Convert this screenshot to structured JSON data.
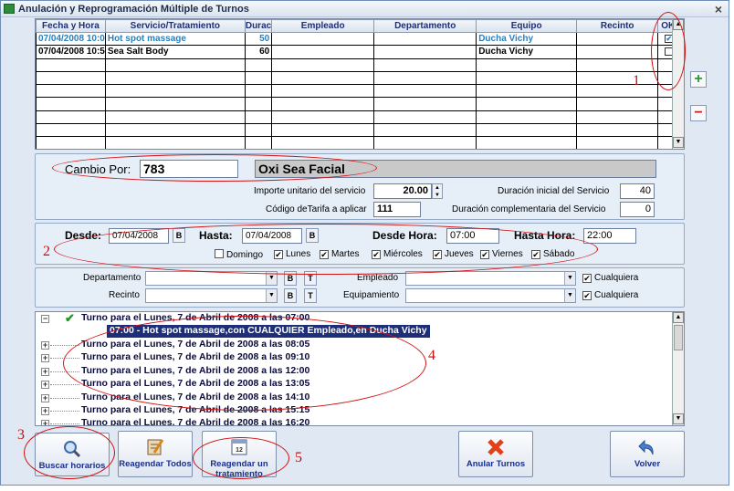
{
  "window": {
    "title": "Anulación y Reprogramación Múltiple de Turnos",
    "close": "×"
  },
  "grid": {
    "columns": [
      "Fecha y Hora",
      "Servicio/Tratamiento",
      "Durac",
      "Empleado",
      "Departamento",
      "Equipo",
      "Recinto",
      "OK"
    ],
    "rows": [
      {
        "fecha": "07/04/2008 10:0",
        "servicio": "Hot spot massage",
        "dur": "50",
        "empleado": "",
        "depto": "",
        "equipo": "Ducha Vichy",
        "recinto": "",
        "ok": "✔"
      },
      {
        "fecha": "07/04/2008 10:5",
        "servicio": "Sea Salt Body",
        "dur": "60",
        "empleado": "",
        "depto": "",
        "equipo": "Ducha Vichy",
        "recinto": "",
        "ok": ""
      }
    ]
  },
  "cambio": {
    "label": "Cambio Por:",
    "code": "783",
    "name": "Oxi Sea Facial",
    "importe_label": "Importe unitario del servicio",
    "importe": "20.00",
    "tarifa_label": "Código deTarifa a aplicar",
    "tarifa": "111",
    "dur_ini_label": "Duración inicial del Servicio",
    "dur_ini": "40",
    "dur_comp_label": "Duración  complementaria  del Servicio",
    "dur_comp": "0"
  },
  "filtros": {
    "desde_label": "Desde:",
    "desde": "07/04/2008",
    "hasta_label": "Hasta:",
    "hasta": "07/04/2008",
    "b": "B",
    "desde_hora_label": "Desde Hora:",
    "desde_hora": "07:00",
    "hasta_hora_label": "Hasta Hora:",
    "hasta_hora": "22:00",
    "dias": [
      {
        "label": "Domingo",
        "checked": false
      },
      {
        "label": "Lunes",
        "checked": true
      },
      {
        "label": "Martes",
        "checked": true
      },
      {
        "label": "Miércoles",
        "checked": true
      },
      {
        "label": "Jueves",
        "checked": true
      },
      {
        "label": "Viernes",
        "checked": true
      },
      {
        "label": "Sábado",
        "checked": true
      }
    ]
  },
  "recursos": {
    "departamento_label": "Departamento",
    "recinto_label": "Recinto",
    "empleado_label": "Empleado",
    "equipamiento_label": "Equipamiento",
    "b": "B",
    "t": "T",
    "cualquiera": "Cualquiera"
  },
  "tree": {
    "root": "Turno para el Lunes, 7 de Abril de 2008 a las 07:00",
    "child": "07:00 - Hot spot massage,con CUALQUIER Empleado,en Ducha Vichy",
    "items": [
      "Turno para el Lunes, 7 de Abril de 2008 a las 08:05",
      "Turno para el Lunes, 7 de Abril de 2008 a las 09:10",
      "Turno para el Lunes, 7 de Abril de 2008 a las 12:00",
      "Turno para el Lunes, 7 de Abril de 2008 a las 13:05",
      "Turno para el Lunes, 7 de Abril de 2008 a las 14:10",
      "Turno para el Lunes, 7 de Abril de 2008 a las 15:15",
      "Turno para el Lunes, 7 de Abril de 2008 a las 16:20"
    ]
  },
  "buttons": {
    "buscar": "Buscar horarios",
    "reagendar_todos": "Reagendar Todos",
    "reagendar_uno": "Reagendar un tratamiento",
    "anular": "Anular Turnos",
    "volver": "Volver"
  },
  "annotations": [
    "1",
    "2",
    "3",
    "4",
    "5"
  ],
  "colors": {
    "selected_row": "#2d7fb8",
    "annotation": "#d21010",
    "tree_selected": "#1c2f78"
  }
}
